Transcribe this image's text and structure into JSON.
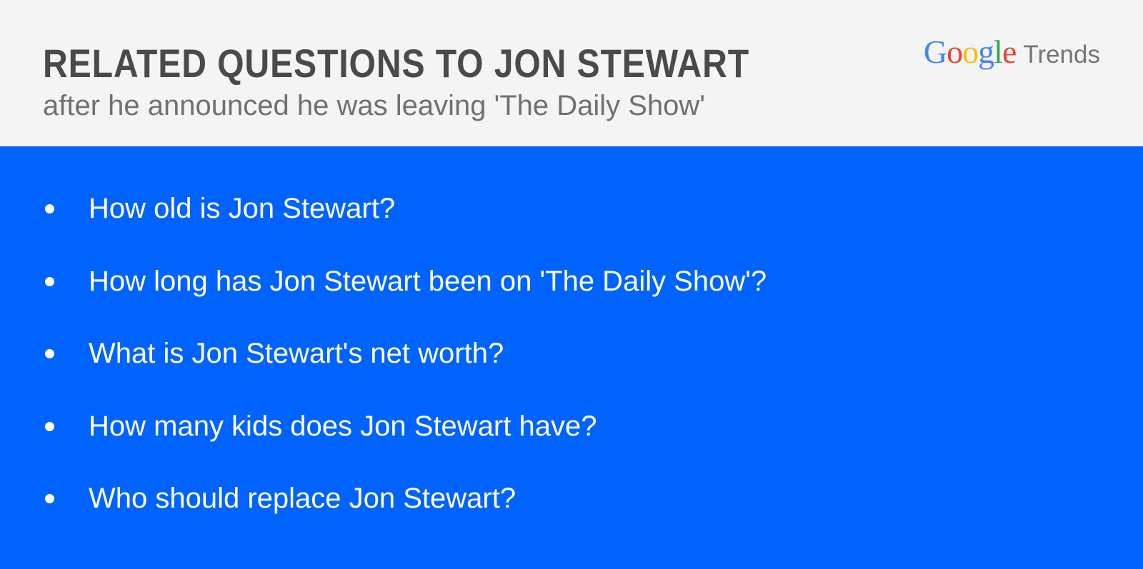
{
  "header": {
    "title": "RELATED QUESTIONS TO JON STEWART",
    "subtitle": "after he announced he was leaving 'The Daily Show'",
    "logo": {
      "google_letters": [
        "G",
        "o",
        "o",
        "g",
        "l",
        "e"
      ],
      "product": "Trends"
    }
  },
  "questions": [
    "How old is Jon Stewart?",
    "How long has Jon Stewart been on 'The Daily Show'?",
    "What is Jon Stewart's net worth?",
    "How many kids does Jon Stewart have?",
    "Who should replace Jon Stewart?"
  ],
  "colors": {
    "header_background": "#f4f4f4",
    "panel_background": "#0163fe",
    "title_text": "#4a4a4a",
    "subtitle_text": "#707070",
    "question_text": "#ffffff"
  }
}
